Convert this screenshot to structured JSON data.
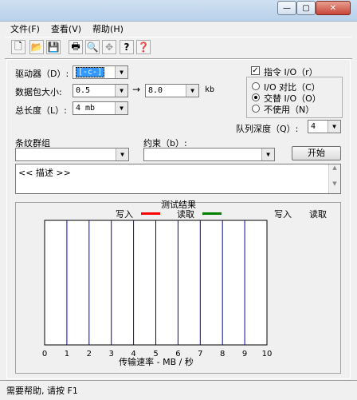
{
  "window": {
    "minimize_glyph": "—",
    "maximize_glyph": "▢",
    "close_glyph": "✕"
  },
  "menu": [
    "文件(F)",
    "查看(V)",
    "帮助(H)"
  ],
  "toolbar": {
    "icons": [
      "new-file-icon",
      "open-folder-icon",
      "save-disk-icon",
      "print-icon",
      "print-preview-icon",
      "crosshair-icon",
      "help-icon",
      "context-help-icon"
    ],
    "glyphs": [
      "🗋",
      "📂",
      "💾",
      "🖶",
      "🔍",
      "✥",
      "?",
      "❓"
    ]
  },
  "form": {
    "drive_label": "驱动器（D）:",
    "drive_value": "[-c-]",
    "packet_label": "数据包大小:",
    "packet_from": "0.5",
    "packet_arrow": "→",
    "packet_to": "8.0",
    "packet_unit": "kb",
    "total_label": "总长度（L）:",
    "total_value": "4 mb",
    "command_io_label": "指令 I/O（r）",
    "command_io_checked": true,
    "radio_compare": "I/O 对比（C）",
    "radio_alternate": "交替 I/O（O）",
    "radio_none": "不使用（N）",
    "radio_selected": "alternate",
    "queue_label": "队列深度（Q）:",
    "queue_value": "4",
    "stripe_label": "条纹群组",
    "stripe_value": "",
    "constraint_label": "约束（b）:",
    "constraint_value": "",
    "start_button": "开始",
    "description": "<< 描述 >>"
  },
  "chart_data": {
    "type": "bar",
    "title": "测试结果",
    "legend": [
      {
        "name": "写入",
        "color": "#ff0000"
      },
      {
        "name": "读取",
        "color": "#008000"
      }
    ],
    "value_headers": [
      "写入",
      "读取"
    ],
    "xlabel": "传输速率 - MB / 秒",
    "xlim": [
      0,
      10
    ],
    "ticks": [
      "0",
      "1",
      "2",
      "3",
      "4",
      "5",
      "6",
      "7",
      "8",
      "9",
      "10"
    ],
    "gridline_color": "#0000cc",
    "series": [
      {
        "name": "写入",
        "values": []
      },
      {
        "name": "读取",
        "values": []
      }
    ]
  },
  "status_text": "需要帮助, 请按 F1"
}
